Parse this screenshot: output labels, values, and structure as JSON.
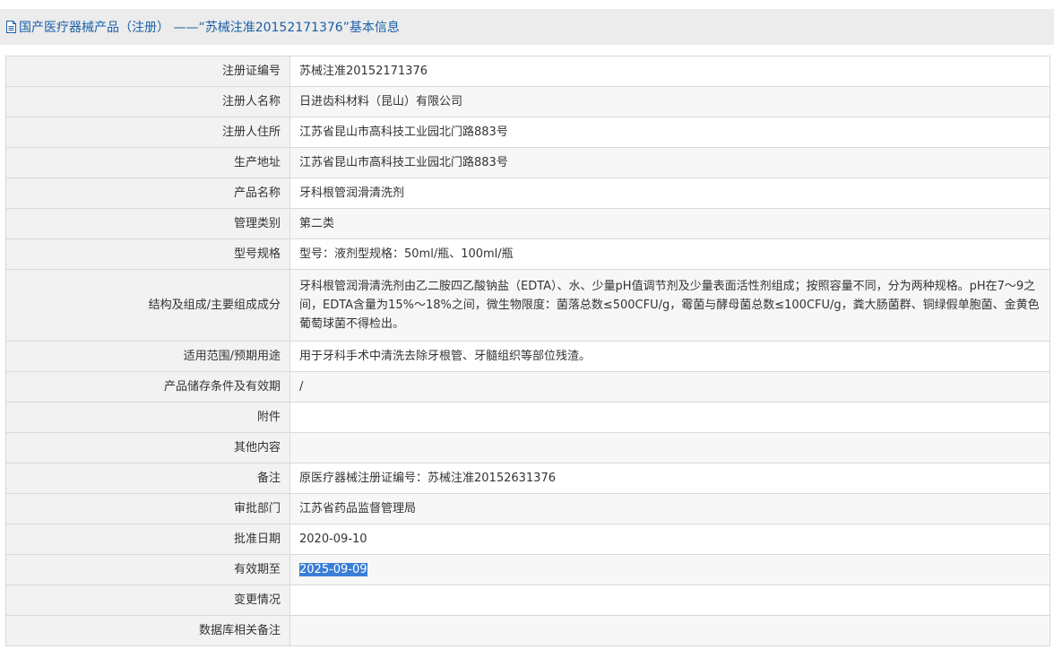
{
  "page_title": "国产医疗器械产品（注册） ——“苏械注准20152171376”基本信息",
  "colors": {
    "title_text": "#1a5fa8",
    "label_bg": "#f2f2f2",
    "border": "#d9d9d9",
    "selection": "#3a7fd6"
  },
  "icons": {
    "title_icon": "document-icon"
  },
  "rows": [
    {
      "label": "注册证编号",
      "value": "苏械注准20152171376"
    },
    {
      "label": "注册人名称",
      "value": "日进齿科材料（昆山）有限公司"
    },
    {
      "label": "注册人住所",
      "value": "江苏省昆山市高科技工业园北门路883号"
    },
    {
      "label": "生产地址",
      "value": "江苏省昆山市高科技工业园北门路883号"
    },
    {
      "label": "产品名称",
      "value": "牙科根管润滑清洗剂"
    },
    {
      "label": "管理类别",
      "value": "第二类"
    },
    {
      "label": "型号规格",
      "value": "型号：液剂型规格：50ml/瓶、100ml/瓶"
    },
    {
      "label": "结构及组成/主要组成成分",
      "value": "牙科根管润滑清洗剂由乙二胺四乙酸钠盐（EDTA）、水、少量pH值调节剂及少量表面活性剂组成；按照容量不同，分为两种规格。pH在7～9之间，EDTA含量为15%～18%之间，微生物限度：菌落总数≤500CFU/g，霉菌与酵母菌总数≤100CFU/g，粪大肠菌群、铜绿假单胞菌、金黄色葡萄球菌不得检出。"
    },
    {
      "label": "适用范围/预期用途",
      "value": "用于牙科手术中清洗去除牙根管、牙髓组织等部位残渣。"
    },
    {
      "label": "产品储存条件及有效期",
      "value": "/"
    },
    {
      "label": "附件",
      "value": ""
    },
    {
      "label": "其他内容",
      "value": ""
    },
    {
      "label": "备注",
      "value": "原医疗器械注册证编号：苏械注准20152631376"
    },
    {
      "label": "审批部门",
      "value": "江苏省药品监督管理局"
    },
    {
      "label": "批准日期",
      "value": "2020-09-10"
    },
    {
      "label": "有效期至",
      "value": "2025-09-09"
    },
    {
      "label": "变更情况",
      "value": ""
    },
    {
      "label": "数据库相关备注",
      "value": ""
    }
  ]
}
